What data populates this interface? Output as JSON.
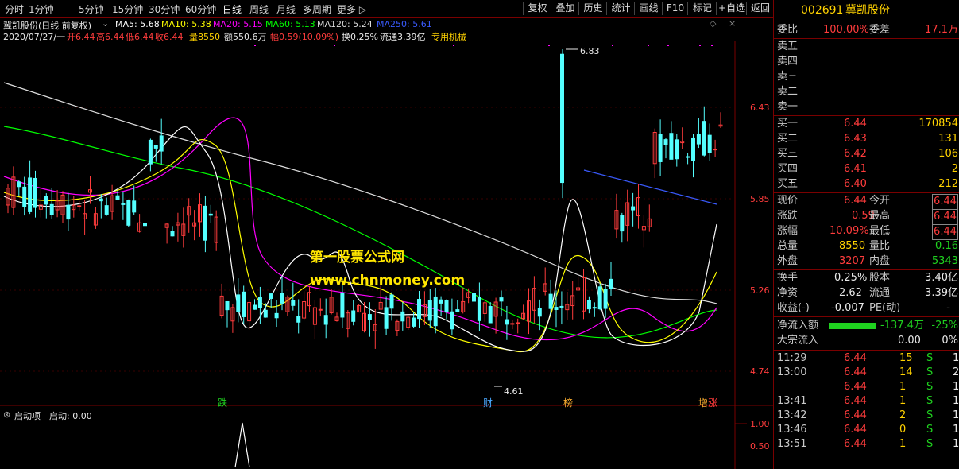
{
  "toolbar": {
    "periods": [
      "分时",
      "1分钟",
      "5分钟",
      "15分钟",
      "30分钟",
      "60分钟",
      "日线",
      "周线",
      "月线",
      "多周期",
      "更多 ▷"
    ],
    "active_period": "日线",
    "buttons": [
      "复权",
      "叠加",
      "历史",
      "统计",
      "画线",
      "F10",
      "标记",
      "+自选",
      "返回"
    ]
  },
  "chart": {
    "header_title": "冀凯股份(日线 前复权)",
    "ma_legend": [
      {
        "label": "MA5: 5.68",
        "color": "#ffffff"
      },
      {
        "label": "MA10: 5.38",
        "color": "#ffff00"
      },
      {
        "label": "MA20: 5.15",
        "color": "#ff00ff"
      },
      {
        "label": "MA60: 5.13",
        "color": "#00ff00"
      },
      {
        "label": "MA120: 5.24",
        "color": "#dddddd"
      },
      {
        "label": "MA250: 5.61",
        "color": "#3a5bff"
      }
    ],
    "info_line": {
      "date": "2020/07/27/一",
      "open": "开6.44",
      "high": "高6.44",
      "low": "低6.44",
      "close": "收6.44",
      "volume": "量8550",
      "amount": "额550.6万",
      "change": "幅0.59(10.09%)",
      "turnover": "换0.25%",
      "float_cap": "流通3.39亿",
      "sector": "专用机械"
    },
    "price_axis": [
      "6.43",
      "5.85",
      "5.26",
      "4.74"
    ],
    "high_label": "6.83",
    "low_label": "4.61",
    "event_markers": [
      {
        "text": "跌",
        "color": "#1fd11f"
      },
      {
        "text": "财",
        "color": "#4aa8ff"
      },
      {
        "text": "榜",
        "color": "#ffb030"
      },
      {
        "text": "增",
        "color": "#ffb030"
      },
      {
        "text": "涨",
        "color": "#ff3c3c"
      }
    ],
    "watermark_line1": "第一股票公式网",
    "watermark_line2": "www.chnmoney.com",
    "colors": {
      "up": "#ff3c3c",
      "down": "#54ffff",
      "ma5": "#ffffff",
      "ma10": "#ffff00",
      "ma20": "#ff00ff",
      "ma60": "#00ff00",
      "ma120": "#dddddd",
      "ma250": "#3a5bff"
    }
  },
  "indicator": {
    "name": "启动项",
    "value": "启动: 0.00",
    "axis": [
      "1.00",
      "0.50"
    ]
  },
  "stock": {
    "code": "002691",
    "name": "冀凯股份",
    "weibi_label": "委比",
    "weibi_value": "100.00%",
    "weicha_label": "委差",
    "weicha_value": "17.1万",
    "sells": [
      {
        "label": "卖五",
        "price": "",
        "vol": ""
      },
      {
        "label": "卖四",
        "price": "",
        "vol": ""
      },
      {
        "label": "卖三",
        "price": "",
        "vol": ""
      },
      {
        "label": "卖二",
        "price": "",
        "vol": ""
      },
      {
        "label": "卖一",
        "price": "",
        "vol": ""
      }
    ],
    "buys": [
      {
        "label": "买一",
        "price": "6.44",
        "vol": "170854"
      },
      {
        "label": "买二",
        "price": "6.43",
        "vol": "131"
      },
      {
        "label": "买三",
        "price": "6.42",
        "vol": "106"
      },
      {
        "label": "买四",
        "price": "6.41",
        "vol": "2"
      },
      {
        "label": "买五",
        "price": "6.40",
        "vol": "212"
      }
    ],
    "quote": [
      {
        "l1": "现价",
        "v1": "6.44",
        "l2": "今开",
        "v2": "6.44"
      },
      {
        "l1": "涨跌",
        "v1": "0.59",
        "l2": "最高",
        "v2": "6.44"
      },
      {
        "l1": "涨幅",
        "v1": "10.09%",
        "l2": "最低",
        "v2": "6.44"
      },
      {
        "l1": "总量",
        "v1": "8550",
        "l2": "量比",
        "v2": "0.16"
      },
      {
        "l1": "外盘",
        "v1": "3207",
        "l2": "内盘",
        "v2": "5343"
      }
    ],
    "stats": [
      {
        "l1": "换手",
        "v1": "0.25%",
        "l2": "股本",
        "v2": "3.40亿"
      },
      {
        "l1": "净资",
        "v1": "2.62",
        "l2": "流通",
        "v2": "3.39亿"
      },
      {
        "l1": "收益(-)",
        "v1": "-0.007",
        "l2": "PE(动)",
        "v2": "-"
      }
    ],
    "netflow_label": "净流入额",
    "netflow_value": "-137.4万",
    "netflow_pct": "-25%",
    "block_label": "大宗流入",
    "block_value": "0.00",
    "block_pct": "0%",
    "ticks": [
      {
        "time": "11:29",
        "price": "6.44",
        "vol": "15",
        "side": "S",
        "num": "1"
      },
      {
        "time": "13:00",
        "price": "6.44",
        "vol": "14",
        "side": "S",
        "num": "2"
      },
      {
        "time": "",
        "price": "6.44",
        "vol": "1",
        "side": "S",
        "num": "1"
      },
      {
        "time": "13:41",
        "price": "6.44",
        "vol": "1",
        "side": "S",
        "num": "1"
      },
      {
        "time": "13:42",
        "price": "6.44",
        "vol": "2",
        "side": "S",
        "num": "1"
      },
      {
        "time": "13:46",
        "price": "6.44",
        "vol": "0",
        "side": "S",
        "num": "1"
      },
      {
        "time": "13:51",
        "price": "6.44",
        "vol": "1",
        "side": "S",
        "num": "1"
      }
    ]
  }
}
